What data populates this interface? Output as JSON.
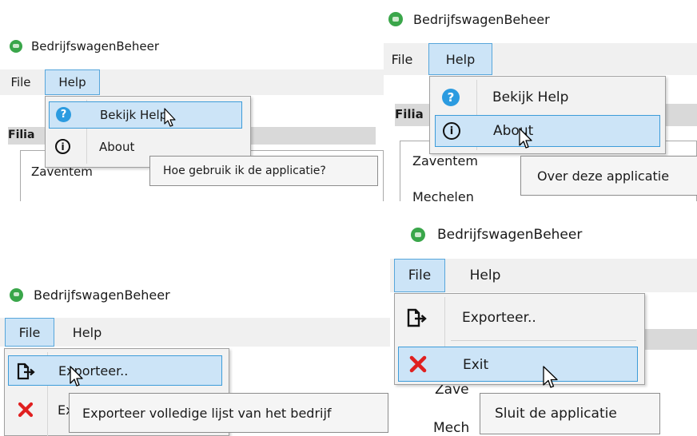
{
  "app": {
    "title": "BedrijfswagenBeheer",
    "accent": "#3aa64a"
  },
  "menu": {
    "file": "File",
    "help": "Help"
  },
  "help_menu": {
    "view_help": "Bekijk Help",
    "about": "About",
    "view_help_tooltip": "Hoe gebruik ik de applicatie?",
    "about_tooltip": "Over deze applicatie"
  },
  "file_menu": {
    "export": "Exporteer..",
    "exit": "Exit",
    "export_tooltip": "Exporteer volledige lijst van het bedrijf",
    "exit_tooltip": "Sluit de applicatie"
  },
  "background": {
    "section_label": "Filia",
    "branches": [
      "Zaventem",
      "Mechelen"
    ],
    "partial": {
      "zave": "Zave",
      "mech": "Mech"
    }
  },
  "colors": {
    "highlight_bg": "#cce4f7",
    "highlight_border": "#3d9cd9",
    "menu_bg": "#f2f2f2",
    "tooltip_bg": "#f5f5f5",
    "exit_red": "#e02020",
    "help_blue": "#2b9be0"
  }
}
